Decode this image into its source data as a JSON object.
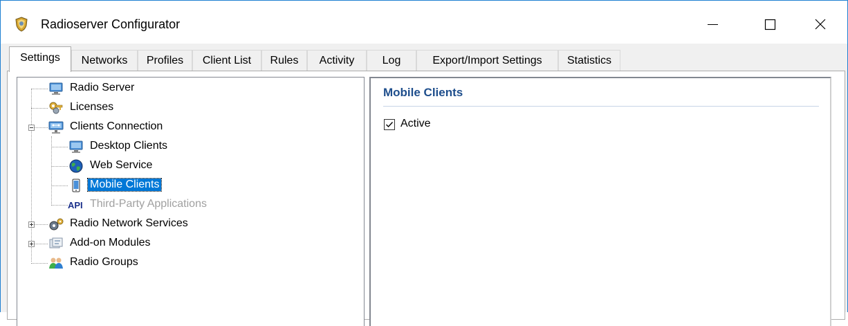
{
  "window": {
    "title": "Radioserver Configurator",
    "controls": {
      "minimize": "minimize",
      "maximize": "maximize",
      "close": "close"
    }
  },
  "tabs": [
    {
      "label": "Settings",
      "active": true
    },
    {
      "label": "Networks"
    },
    {
      "label": "Profiles"
    },
    {
      "label": "Client List"
    },
    {
      "label": "Rules"
    },
    {
      "label": "Activity"
    },
    {
      "label": "Log"
    },
    {
      "label": "Export/Import Settings"
    },
    {
      "label": "Statistics"
    }
  ],
  "tree": {
    "items": [
      {
        "label": "Radio Server",
        "icon": "monitor-icon"
      },
      {
        "label": "Licenses",
        "icon": "keys-icon"
      },
      {
        "label": "Clients Connection",
        "icon": "network-icon",
        "expanded": true
      },
      {
        "label": "Desktop Clients",
        "icon": "monitor-icon"
      },
      {
        "label": "Web Service",
        "icon": "globe-icon"
      },
      {
        "label": "Mobile Clients",
        "icon": "mobile-phone-icon",
        "selected": true
      },
      {
        "label": "Third-Party Applications",
        "icon": "api-icon",
        "disabled": true
      },
      {
        "label": "Radio Network Services",
        "icon": "gears-icon",
        "expanded": false
      },
      {
        "label": "Add-on Modules",
        "icon": "modules-icon",
        "expanded": false
      },
      {
        "label": "Radio Groups",
        "icon": "users-icon"
      }
    ],
    "api_icon_text": "API"
  },
  "detail": {
    "title": "Mobile Clients",
    "active_checkbox": {
      "label": "Active",
      "checked": true
    }
  },
  "colors": {
    "selection": "#0078d7",
    "section_title": "#1e4e8c",
    "window_border": "#1e7fd1"
  }
}
